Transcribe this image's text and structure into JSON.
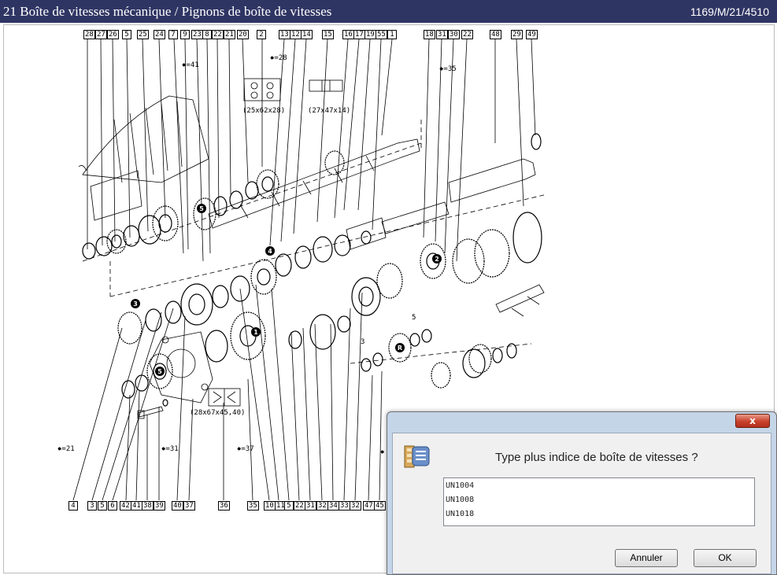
{
  "window": {
    "title": "21 Boîte de vitesses mécanique / Pignons de boîte de vitesses",
    "reference": "1169/M/21/4510"
  },
  "diagram": {
    "top_labels": [
      "28",
      "27",
      "26",
      "5",
      "25",
      "24",
      "7",
      "9",
      "23",
      "8",
      "22",
      "21",
      "20",
      "2",
      "13",
      "12",
      "14",
      "15",
      "16",
      "17",
      "19",
      "55",
      "1",
      "18",
      "31",
      "30",
      "22",
      "48",
      "29",
      "49"
    ],
    "bottom_labels": [
      "4",
      "3",
      "5",
      "6",
      "42",
      "41",
      "38",
      "39",
      "40",
      "37",
      "36",
      "35",
      "10",
      "11",
      "5",
      "22",
      "31",
      "32",
      "34",
      "33",
      "32",
      "47",
      "45"
    ],
    "side_labels": [
      "3",
      "5"
    ],
    "notes": {
      "n41": "=41",
      "n28": "=28",
      "n35": "=35",
      "n21": "=21",
      "n31": "=31",
      "n37": "=37",
      "dim1": "(25x62x28)",
      "dim2": "(27x47x14)",
      "dim3": "(28x67x45,40)"
    },
    "circled_marks": [
      "5",
      "4",
      "2",
      "3",
      "5",
      "1",
      "R"
    ]
  },
  "dialog": {
    "close_label": "x",
    "prompt": "Type plus indice de boîte de vitesses ?",
    "options": [
      "UN1004",
      "UN1008",
      "UN1018"
    ],
    "cancel_label": "Annuler",
    "ok_label": "OK"
  }
}
